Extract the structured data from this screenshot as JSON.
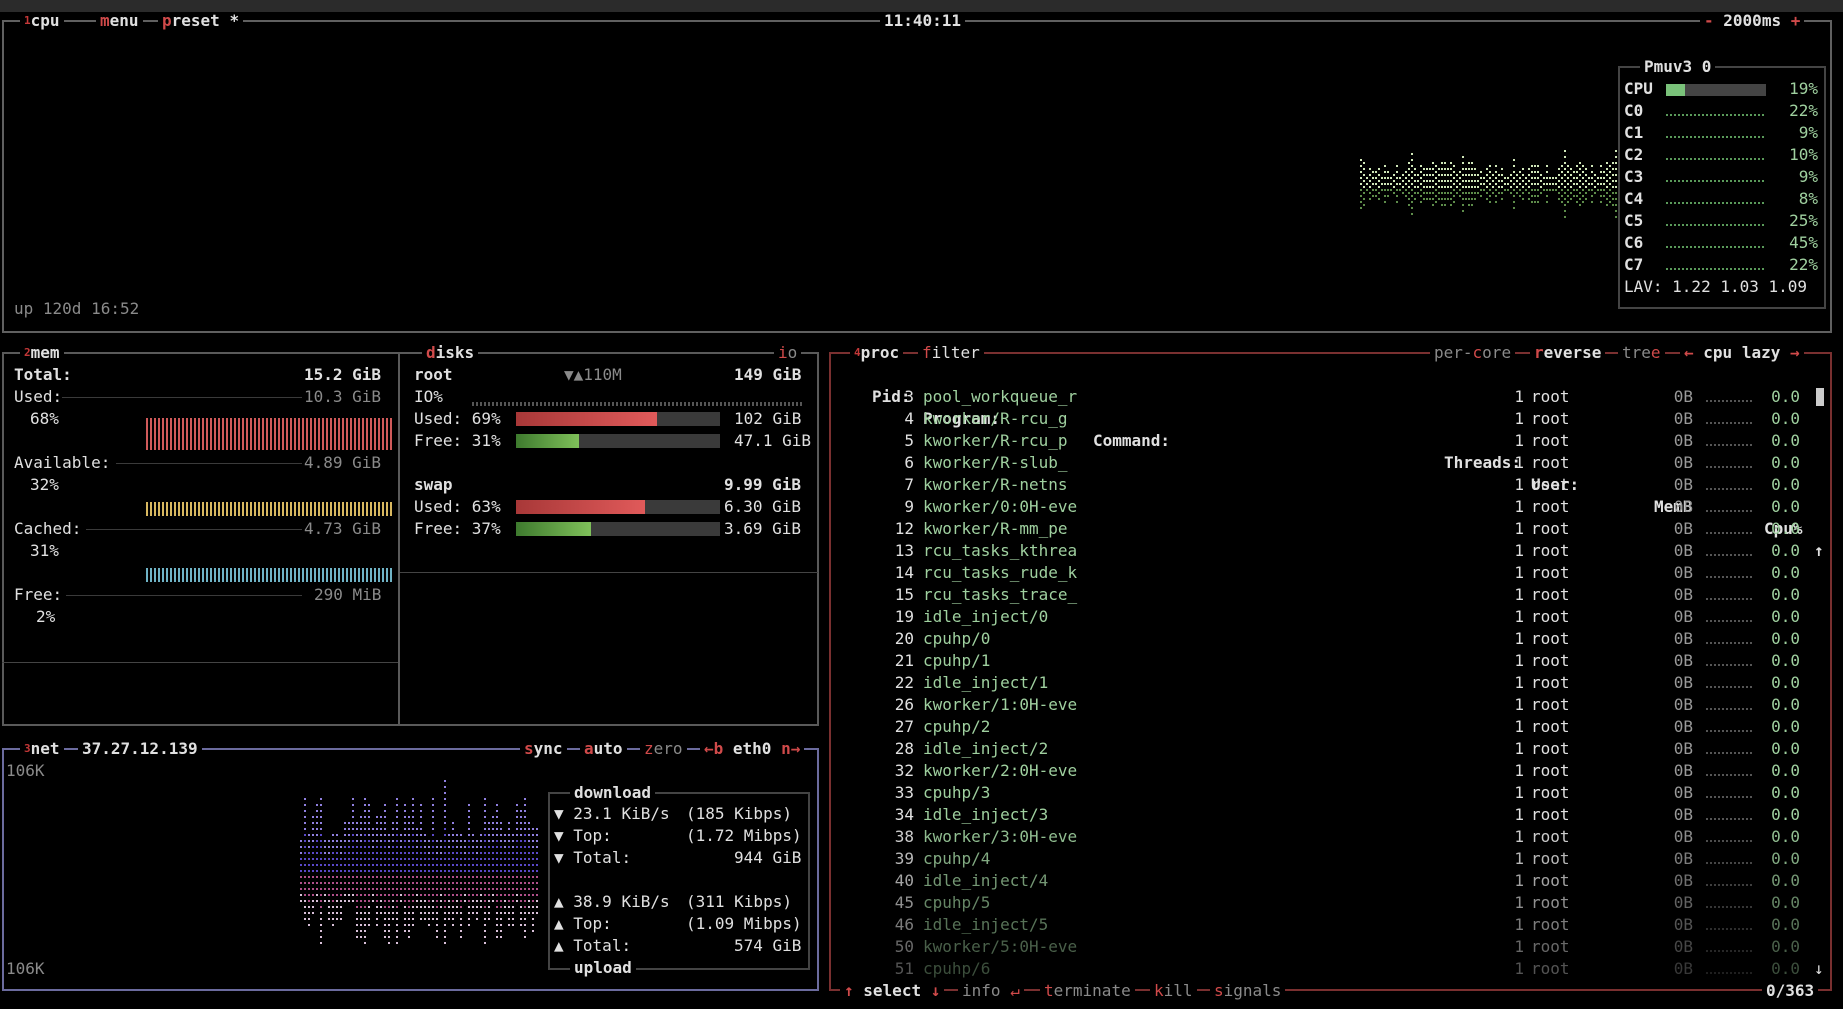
{
  "top": {
    "cpu_label": "cpu",
    "menu_label": "menu",
    "preset_label": "preset *",
    "clock": "11:40:11",
    "update_ms": "2000ms",
    "minus": "-",
    "plus": "+",
    "uptime": "up 120d 16:52"
  },
  "cpu": {
    "panel_title": "Pmuv3 0",
    "rows": [
      {
        "label": "CPU",
        "pct": "19%",
        "level": 0.19
      },
      {
        "label": "C0",
        "pct": "22%",
        "level": 0.22
      },
      {
        "label": "C1",
        "pct": "9%",
        "level": 0.09
      },
      {
        "label": "C2",
        "pct": "10%",
        "level": 0.1
      },
      {
        "label": "C3",
        "pct": "9%",
        "level": 0.09
      },
      {
        "label": "C4",
        "pct": "8%",
        "level": 0.08
      },
      {
        "label": "C5",
        "pct": "25%",
        "level": 0.25
      },
      {
        "label": "C6",
        "pct": "45%",
        "level": 0.45
      },
      {
        "label": "C7",
        "pct": "22%",
        "level": 0.22
      }
    ],
    "lav": "LAV: 1.22 1.03 1.09"
  },
  "mem": {
    "title": "mem",
    "total_label": "Total:",
    "total_value": "15.2 GiB",
    "used_label": "Used:",
    "used_value": "10.3 GiB",
    "used_pct": "68%",
    "avail_label": "Available:",
    "avail_value": "4.89 GiB",
    "avail_pct": "32%",
    "cached_label": "Cached:",
    "cached_value": "4.73 GiB",
    "cached_pct": "31%",
    "free_label": "Free:",
    "free_value": "290 MiB",
    "free_pct": "2%"
  },
  "disks": {
    "title": "disks",
    "io_label": "io",
    "root_label": "root",
    "root_speed": "▼▲110M",
    "root_size": "149 GiB",
    "io_pct_label": "IO%",
    "root_used_label": "Used: 69%",
    "root_used_value": "102 GiB",
    "root_used_level": 0.69,
    "root_free_label": "Free: 31%",
    "root_free_value": "47.1 GiB",
    "root_free_level": 0.31,
    "swap_label": "swap",
    "swap_size": "9.99 GiB",
    "swap_used_label": "Used: 63%",
    "swap_used_value": "6.30 GiB",
    "swap_used_level": 0.63,
    "swap_free_label": "Free: 37%",
    "swap_free_value": "3.69 GiB",
    "swap_free_level": 0.37
  },
  "net": {
    "title": "net",
    "ip": "37.27.12.139",
    "sync": "sync",
    "auto": "auto",
    "zero": "zero",
    "back_key": "←b",
    "iface": "eth0",
    "next_key": "n→",
    "scale_top": "106K",
    "scale_bottom": "106K",
    "download_label": "download",
    "dl_rate": "23.1 KiB/s",
    "dl_rate_bits": "(185 Kibps)",
    "dl_top_label": "Top:",
    "dl_top": "(1.72 Mibps)",
    "dl_total_label": "Total:",
    "dl_total": "944 GiB",
    "ul_rate": "38.9 KiB/s",
    "ul_rate_bits": "(311 Kibps)",
    "ul_top_label": "Top:",
    "ul_top": "(1.09 Mibps)",
    "ul_total_label": "Total:",
    "ul_total": "574 GiB",
    "upload_label": "upload"
  },
  "proc": {
    "title": "proc",
    "filter": "filter",
    "per_core": "per-core",
    "reverse": "reverse",
    "tree": "tree",
    "sort_left": "←",
    "sort_field": "cpu lazy",
    "sort_right": "→",
    "headers": {
      "pid": "Pid:",
      "program": "Program:",
      "command": "Command:",
      "threads": "Threads:",
      "user": "User:",
      "mem": "MemB",
      "cpu": "Cpu%"
    },
    "rows": [
      {
        "pid": "3",
        "program": "pool_workqueue_r",
        "threads": "1",
        "user": "root",
        "mem": "0B",
        "cpu": "0.0"
      },
      {
        "pid": "4",
        "program": "kworker/R-rcu_g",
        "threads": "1",
        "user": "root",
        "mem": "0B",
        "cpu": "0.0"
      },
      {
        "pid": "5",
        "program": "kworker/R-rcu_p",
        "threads": "1",
        "user": "root",
        "mem": "0B",
        "cpu": "0.0"
      },
      {
        "pid": "6",
        "program": "kworker/R-slub_",
        "threads": "1",
        "user": "root",
        "mem": "0B",
        "cpu": "0.0"
      },
      {
        "pid": "7",
        "program": "kworker/R-netns",
        "threads": "1",
        "user": "root",
        "mem": "0B",
        "cpu": "0.0"
      },
      {
        "pid": "9",
        "program": "kworker/0:0H-eve",
        "threads": "1",
        "user": "root",
        "mem": "0B",
        "cpu": "0.0"
      },
      {
        "pid": "12",
        "program": "kworker/R-mm_pe",
        "threads": "1",
        "user": "root",
        "mem": "0B",
        "cpu": "0.0"
      },
      {
        "pid": "13",
        "program": "rcu_tasks_kthrea",
        "threads": "1",
        "user": "root",
        "mem": "0B",
        "cpu": "0.0"
      },
      {
        "pid": "14",
        "program": "rcu_tasks_rude_k",
        "threads": "1",
        "user": "root",
        "mem": "0B",
        "cpu": "0.0"
      },
      {
        "pid": "15",
        "program": "rcu_tasks_trace_",
        "threads": "1",
        "user": "root",
        "mem": "0B",
        "cpu": "0.0"
      },
      {
        "pid": "19",
        "program": "idle_inject/0",
        "threads": "1",
        "user": "root",
        "mem": "0B",
        "cpu": "0.0"
      },
      {
        "pid": "20",
        "program": "cpuhp/0",
        "threads": "1",
        "user": "root",
        "mem": "0B",
        "cpu": "0.0"
      },
      {
        "pid": "21",
        "program": "cpuhp/1",
        "threads": "1",
        "user": "root",
        "mem": "0B",
        "cpu": "0.0"
      },
      {
        "pid": "22",
        "program": "idle_inject/1",
        "threads": "1",
        "user": "root",
        "mem": "0B",
        "cpu": "0.0"
      },
      {
        "pid": "26",
        "program": "kworker/1:0H-eve",
        "threads": "1",
        "user": "root",
        "mem": "0B",
        "cpu": "0.0"
      },
      {
        "pid": "27",
        "program": "cpuhp/2",
        "threads": "1",
        "user": "root",
        "mem": "0B",
        "cpu": "0.0"
      },
      {
        "pid": "28",
        "program": "idle_inject/2",
        "threads": "1",
        "user": "root",
        "mem": "0B",
        "cpu": "0.0"
      },
      {
        "pid": "32",
        "program": "kworker/2:0H-eve",
        "threads": "1",
        "user": "root",
        "mem": "0B",
        "cpu": "0.0"
      },
      {
        "pid": "33",
        "program": "cpuhp/3",
        "threads": "1",
        "user": "root",
        "mem": "0B",
        "cpu": "0.0"
      },
      {
        "pid": "34",
        "program": "idle_inject/3",
        "threads": "1",
        "user": "root",
        "mem": "0B",
        "cpu": "0.0"
      },
      {
        "pid": "38",
        "program": "kworker/3:0H-eve",
        "threads": "1",
        "user": "root",
        "mem": "0B",
        "cpu": "0.0"
      },
      {
        "pid": "39",
        "program": "cpuhp/4",
        "threads": "1",
        "user": "root",
        "mem": "0B",
        "cpu": "0.0"
      },
      {
        "pid": "40",
        "program": "idle_inject/4",
        "threads": "1",
        "user": "root",
        "mem": "0B",
        "cpu": "0.0"
      },
      {
        "pid": "45",
        "program": "cpuhp/5",
        "threads": "1",
        "user": "root",
        "mem": "0B",
        "cpu": "0.0"
      },
      {
        "pid": "46",
        "program": "idle_inject/5",
        "threads": "1",
        "user": "root",
        "mem": "0B",
        "cpu": "0.0"
      },
      {
        "pid": "50",
        "program": "kworker/5:0H-eve",
        "threads": "1",
        "user": "root",
        "mem": "0B",
        "cpu": "0.0"
      },
      {
        "pid": "51",
        "program": "cpuhp/6",
        "threads": "1",
        "user": "root",
        "mem": "0B",
        "cpu": "0.0"
      }
    ],
    "footer": {
      "up_arrow": "↑",
      "select": "select",
      "down_arrow": "↓",
      "info": "info",
      "terminate": "terminate",
      "kill": "kill",
      "signals": "signals",
      "count": "0/363"
    }
  },
  "colors": {
    "accent_red": "#d04a4a",
    "cpu_green": "#7ac27a",
    "mem_used": "#d05a5a",
    "mem_avail": "#d8b860",
    "mem_cached": "#6fb3c6",
    "net_purple": "#6a5ad0"
  }
}
